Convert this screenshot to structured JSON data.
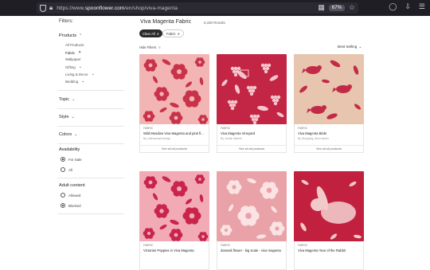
{
  "browser": {
    "url_prefix": "https://www.",
    "url_domain": "spoonflower.com",
    "url_path": "/en/shop/viva-magenta",
    "zoom": "67%"
  },
  "sidebar": {
    "title": "Filters:",
    "products": {
      "label": "Products",
      "items": [
        {
          "label": "All Products"
        },
        {
          "label": "Fabric",
          "selected": true
        },
        {
          "label": "Wallpaper"
        },
        {
          "label": "Gifting"
        },
        {
          "label": "Living & Decor"
        },
        {
          "label": "Bedding"
        }
      ]
    },
    "topic": "Topic",
    "style": "Style",
    "colors": "Colors",
    "availability": {
      "label": "Availability",
      "options": [
        {
          "label": "For Sale",
          "checked": true
        },
        {
          "label": "All",
          "checked": false
        }
      ]
    },
    "adult_content": {
      "label": "Adult content",
      "options": [
        {
          "label": "Allowed",
          "checked": false
        },
        {
          "label": "Blocked",
          "checked": true
        }
      ]
    }
  },
  "main": {
    "title": "Viva Magenta Fabric",
    "results": "6,330 Results",
    "clear_all": "Clear All",
    "active_filter": "Fabric",
    "hide_filters": "Hide Filters",
    "sort": "Best Selling",
    "cards": [
      {
        "category": "FABRIC",
        "name": "Wild Meadow Viva Magenta and pink fl...",
        "by": "By cristinamariedesign",
        "see_all": "See all all products",
        "pattern": "floral",
        "bg": "#f3b4b4",
        "fg": "#c9334a"
      },
      {
        "category": "FABRIC",
        "name": "Viva Magenta Vineyard",
        "by": "By Jordan Warren",
        "see_all": "See all all products",
        "pattern": "vineyard",
        "bg": "#c32545",
        "fg": "#f5c6cc"
      },
      {
        "category": "FABRIC",
        "name": "Viva Magenta Birds",
        "by": "By Shopping_Mom-studio",
        "see_all": "See all all products",
        "pattern": "birds",
        "bg": "#e7c5ae",
        "fg": "#c22b48"
      },
      {
        "category": "FABRIC",
        "name": "Victorian Poppies in Viva Magenta",
        "by": "",
        "see_all": "",
        "pattern": "poppies",
        "bg": "#f2aab5",
        "fg": "#c9244a"
      },
      {
        "category": "FABRIC",
        "name": "damask flower - big scale - viva magenta",
        "by": "",
        "see_all": "",
        "pattern": "damask",
        "bg": "#e9a3a8",
        "fg": "#fbe3e3"
      },
      {
        "category": "FABRIC",
        "name": "Viva Magenta Year of the Rabbit",
        "by": "",
        "see_all": "",
        "pattern": "rabbit",
        "bg": "#c2203f",
        "fg": "#f2c9c9"
      }
    ]
  }
}
